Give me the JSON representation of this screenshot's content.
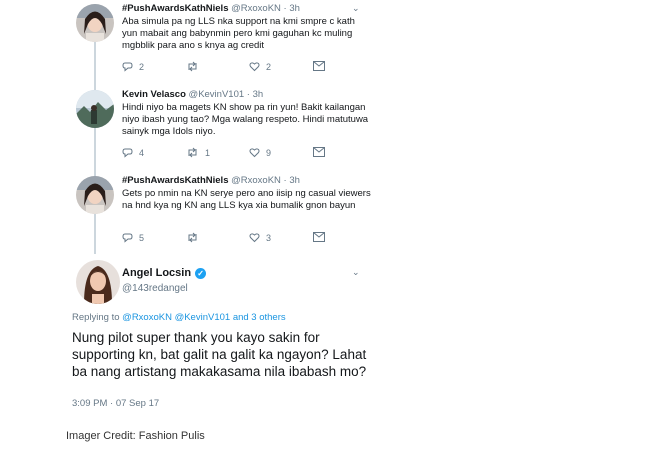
{
  "thread": [
    {
      "name": "#PushAwardsKathNiels",
      "handle": "@RxoxoKN",
      "time": "3h",
      "text": "Aba simula pa ng LLS nka support na kmi smpre c kath yun mabait ang babynmin  pero kmi  gaguhan kc muling mgbblik para ano s knya ag credit",
      "reply_count": "2",
      "retweet_count": "",
      "like_count": "2"
    },
    {
      "name": "Kevin Velasco",
      "handle": "@KevinV101",
      "time": "3h",
      "text": "Hindi niyo ba magets KN show pa rin yun! Bakit kailangan niyo ibash yung tao? Mga walang respeto. Hindi matutuwa sainyk mga Idols niyo.",
      "reply_count": "4",
      "retweet_count": "1",
      "like_count": "9"
    },
    {
      "name": "#PushAwardsKathNiels",
      "handle": "@RxoxoKN",
      "time": "3h",
      "text": "Gets po nmin na KN serye pero ano iisip ng casual viewers na hnd kya ng KN ang LLS kya xia bumalik gnon bayun",
      "reply_count": "5",
      "retweet_count": "",
      "like_count": "3"
    }
  ],
  "main_tweet": {
    "name": "Angel Locsin",
    "handle": "@143redangel",
    "verified_mark": "✓",
    "replying_prefix": "Replying to",
    "replying_to": "@RxoxoKN @KevinV101 and 3 others",
    "text": "Nung pilot super thank you kayo sakin for supporting kn, bat galit na galit ka ngayon? Lahat ba nang artistang makakasama nila ibabash mo?",
    "timestamp": "3:09 PM · 07 Sep 17"
  },
  "separator": "·",
  "chevron": "⌄",
  "credit": "Imager Credit: Fashion Pulis",
  "colors": {
    "accent": "#1da1f2",
    "link": "#1b95e0",
    "muted": "#657786",
    "text": "#14171a",
    "thread_line": "#ccd6dd"
  },
  "icons": [
    "reply-icon",
    "retweet-icon",
    "like-icon",
    "message-icon",
    "chevron-down-icon",
    "verified-icon"
  ]
}
